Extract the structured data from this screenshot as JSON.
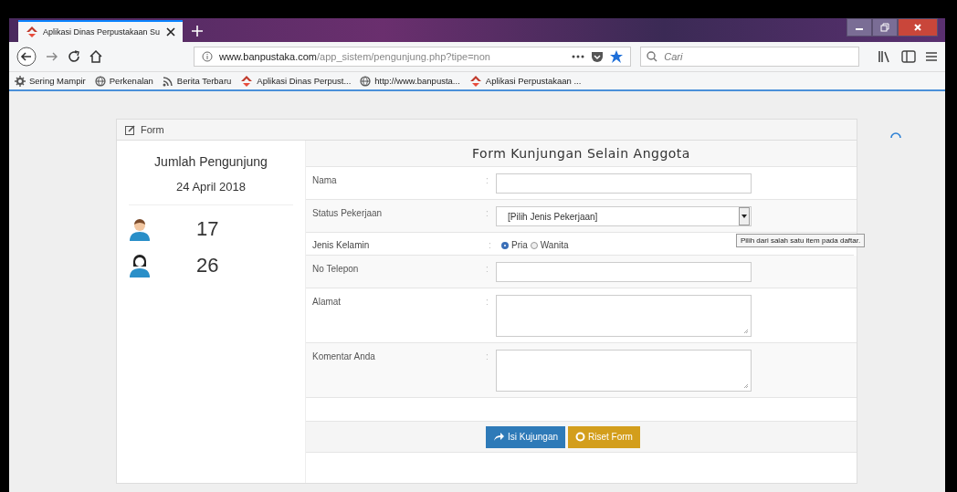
{
  "browser": {
    "tab": {
      "title": "Aplikasi Dinas Perpustakaan Su",
      "selected": true
    },
    "url": {
      "host": "www.banpustaka.com",
      "path": "/app_sistem/pengunjung.php?tipe=non"
    },
    "search": {
      "placeholder": "Cari"
    },
    "bookmarks": [
      {
        "label": "Sering Mampir",
        "kind": "gear"
      },
      {
        "label": "Perkenalan",
        "kind": "globe"
      },
      {
        "label": "Berita Terbaru",
        "kind": "feed"
      },
      {
        "label": "Aplikasi Dinas Perpust...",
        "kind": "logo"
      },
      {
        "label": "http://www.banpusta...",
        "kind": "globe"
      },
      {
        "label": "Aplikasi Perpustakaan ...",
        "kind": "logo"
      }
    ]
  },
  "panel": {
    "title": "Form",
    "visitors": {
      "title": "Jumlah Pengunjung",
      "date": "24 April 2018",
      "counts": [
        {
          "kind": "male",
          "count": "17"
        },
        {
          "kind": "female",
          "count": "26"
        }
      ]
    },
    "form": {
      "title": "Form Kunjungan Selain Anggota",
      "fields": [
        {
          "kind": "text",
          "label": "Nama",
          "separator": ":"
        },
        {
          "kind": "select",
          "label": "Status Pekerjaan",
          "separator": ":",
          "value": "[Pilih Jenis Pekerjaan]",
          "tooltip": "Pilih dari salah satu item pada daftar."
        },
        {
          "kind": "radio",
          "label": "Jenis Kelamin",
          "separator": ":",
          "options": [
            {
              "label": "Pria",
              "selected": true
            },
            {
              "label": "Wanita",
              "selected": false
            }
          ]
        },
        {
          "kind": "text",
          "label": "No Telepon",
          "separator": ":"
        },
        {
          "kind": "textarea",
          "label": "Alamat",
          "separator": ":"
        },
        {
          "kind": "textarea",
          "label": "Komentar Anda",
          "separator": ":"
        }
      ],
      "buttons": [
        {
          "kind": "submit",
          "label": "Isi Kujungan"
        },
        {
          "kind": "reset",
          "label": "Riset Form"
        }
      ]
    }
  }
}
